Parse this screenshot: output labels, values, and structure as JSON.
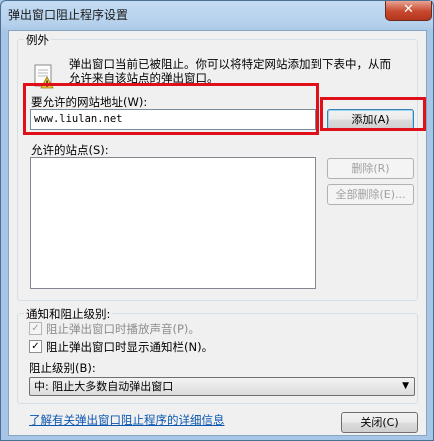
{
  "window": {
    "title": "弹出窗口阻止程序设置",
    "close_glyph": "✕"
  },
  "exceptions": {
    "legend": "例外",
    "description_line1": "弹出窗口当前已被阻止。你可以将特定网站添加到下表中，从而",
    "description_line2": "允许来自该站点的弹出窗口。",
    "address_label": "要允许的网站地址(W):",
    "address_value": "www.liulan.net",
    "add_button": "添加(A)",
    "allowed_label": "允许的站点(S):",
    "remove_button": "删除(R)",
    "remove_all_button": "全部删除(E)..."
  },
  "notifications": {
    "legend": "通知和阻止级别:",
    "play_sound": {
      "label": "阻止弹出窗口时播放声音(P)。",
      "checked": true,
      "enabled": false
    },
    "show_bar": {
      "label": "阻止弹出窗口时显示通知栏(N)。",
      "checked": true,
      "enabled": true
    },
    "blocking_level_label": "阻止级别(B):",
    "blocking_level_value": "中: 阻止大多数自动弹出窗口"
  },
  "footer": {
    "learn_more_link": "了解有关弹出窗口阻止程序的详细信息",
    "close_button": "关闭(C)"
  },
  "icons": {
    "warning": "notepad-warning-icon",
    "check": "✓",
    "dropdown": "▼"
  },
  "colors": {
    "highlight_box": "#e0101a",
    "link": "#0a56b0"
  }
}
